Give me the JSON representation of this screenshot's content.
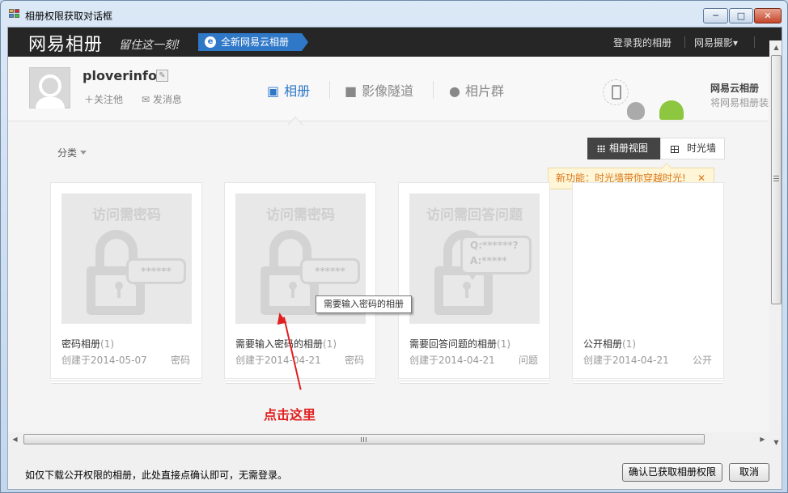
{
  "window": {
    "title": "相册权限获取对话框",
    "min_glyph": "─",
    "max_glyph": "□",
    "close_glyph": "✕"
  },
  "topbar": {
    "logo": "网易相册",
    "slogan": "留住这一刻!",
    "new_button": "全新网易云相册",
    "login_link": "登录我的相册",
    "photo_link": "网易摄影▾"
  },
  "profile": {
    "username": "ploverinfo",
    "follow": "关注他",
    "message": "发消息"
  },
  "tabs": [
    {
      "label": "相册",
      "icon": "image-icon",
      "glyph": "▣",
      "active": true
    },
    {
      "label": "影像隧道",
      "icon": "video-camera-icon",
      "glyph": "■",
      "active": false
    },
    {
      "label": "相片群",
      "icon": "users-icon",
      "glyph": "●",
      "active": false
    }
  ],
  "cloud": {
    "title": "网易云相册",
    "subtitle": "将网易相册装进"
  },
  "toolbar": {
    "category": "分类",
    "album_view": "相册视图",
    "timeline_view": "时光墙",
    "tip": "新功能：时光墙带你穿越时光!",
    "tip_close": "✕"
  },
  "albums": [
    {
      "cover_text": "访问需密码",
      "bubble": "******",
      "name": "密码相册",
      "count": "(1)",
      "date": "创建于2014-05-07",
      "type": "密码"
    },
    {
      "cover_text": "访问需密码",
      "bubble": "******",
      "name": "需要输入密码的相册",
      "count": "(1)",
      "date": "创建于2014-04-21",
      "type": "密码"
    },
    {
      "cover_text": "访问需回答问题",
      "bubble_q": "Q:******?",
      "bubble_a": "A:*****",
      "name": "需要回答问题的相册",
      "count": "(1)",
      "date": "创建于2014-04-21",
      "type": "问题"
    },
    {
      "cover_text": "",
      "name": "公开相册",
      "count": "(1)",
      "date": "创建于2014-04-21",
      "type": "公开"
    }
  ],
  "tooltip": "需要输入密码的相册",
  "annotation": "点击这里",
  "colors": {
    "accent": "#2f78c8",
    "annotation": "#e02020",
    "tip_text": "#d9771a"
  },
  "footer": {
    "hint": "如仅下载公开权限的相册，此处直接点确认即可，无需登录。",
    "confirm": "确认已获取相册权限",
    "cancel": "取消"
  }
}
